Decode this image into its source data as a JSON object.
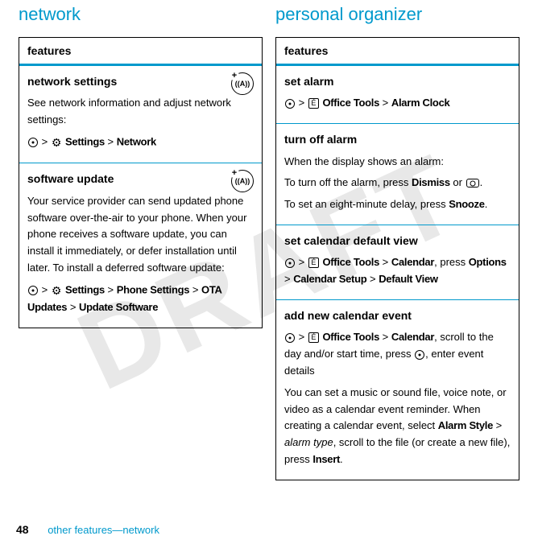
{
  "watermark": "DRAFT",
  "left": {
    "title": "network",
    "header": "features",
    "rows": [
      {
        "title": "network settings",
        "body": "See network information and adjust network settings:",
        "path": {
          "gt1": ">",
          "settings": "Settings",
          "gt2": ">",
          "network": "Network"
        },
        "hasBadge": true
      },
      {
        "title": "software update",
        "body": "Your service provider can send updated phone software over-the-air to your phone. When your phone receives a software update, you can install it immediately, or defer installation until later. To install a deferred software update:",
        "path": {
          "gt1": ">",
          "settings": "Settings",
          "gt2": ">",
          "phone": "Phone Settings",
          "gt3": ">",
          "ota": "OTA Updates",
          "gt4": ">",
          "update": "Update Software"
        },
        "hasBadge": true
      }
    ]
  },
  "right": {
    "title": "personal organizer",
    "header": "features",
    "rows": [
      {
        "title": "set alarm",
        "path": {
          "gt1": ">",
          "tools": "Office Tools",
          "gt2": ">",
          "alarm": "Alarm Clock"
        }
      },
      {
        "title": "turn off alarm",
        "line1": "When the display shows an alarm:",
        "line2a": "To turn off the alarm, press ",
        "dismiss": "Dismiss",
        "line2b": " or ",
        "line2c": ".",
        "line3a": "To set an eight-minute delay, press ",
        "snooze": "Snooze",
        "line3b": "."
      },
      {
        "title": "set calendar default view",
        "path": {
          "gt1": ">",
          "tools": "Office Tools",
          "gt2": ">",
          "calendar": "Calendar",
          "press": ", press ",
          "options": "Options",
          "gt3": ">",
          "setup": "Calendar Setup",
          "gt4": ">",
          "view": "Default View"
        }
      },
      {
        "title": "add new calendar event",
        "path": {
          "gt1": ">",
          "tools": "Office Tools",
          "gt2": ">",
          "calendar": "Calendar",
          "rest1": ", scroll to the day and/or start time, press ",
          "rest2": ", enter event details"
        },
        "body2a": "You can set a music or sound file, voice note, or video as a calendar event reminder. When creating a calendar event, select ",
        "alarmstyle": "Alarm Style",
        "gt": " > ",
        "alarmtype": "alarm type",
        "body2b": ", scroll to the file (or create a new file), press ",
        "insert": "Insert",
        "body2c": "."
      }
    ]
  },
  "footer": {
    "page": "48",
    "text": "other features—network"
  },
  "badgeText": "((A))"
}
